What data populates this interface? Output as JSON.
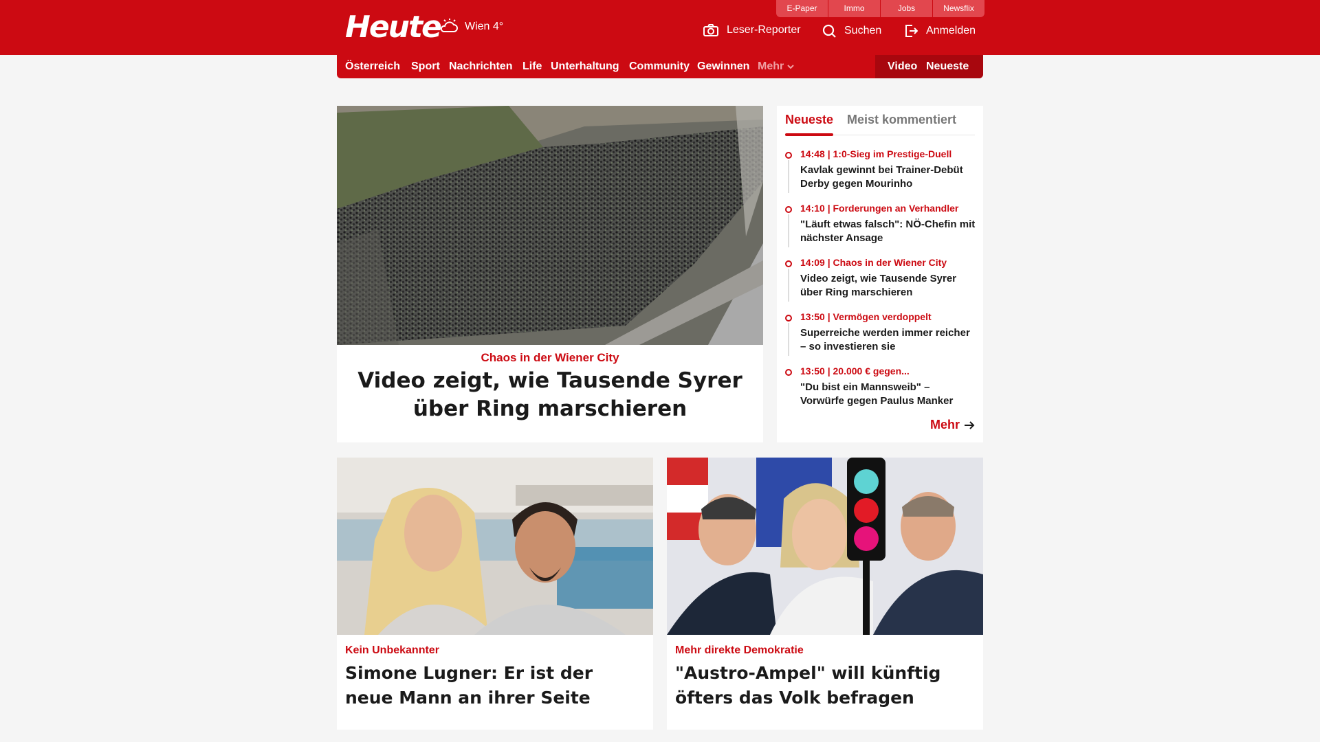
{
  "header": {
    "logo": "Heute",
    "weather": "Wien 4°",
    "service_tabs": [
      "E-Paper",
      "Immo",
      "Jobs",
      "Newsflix"
    ],
    "actions": {
      "reporter": "Leser-Reporter",
      "search": "Suchen",
      "login": "Anmelden"
    }
  },
  "nav": {
    "items": [
      "Österreich",
      "Sport",
      "Nachrichten",
      "Life",
      "Unterhaltung",
      "Community",
      "Gewinnen"
    ],
    "more": "Mehr",
    "video": "Video",
    "latest": "Neueste"
  },
  "hero": {
    "kicker": "Chaos in der Wiener City",
    "title": "Video zeigt, wie Tausende Syrer über Ring marschieren"
  },
  "sidebar": {
    "tabs": [
      "Neueste",
      "Meist kommentiert"
    ],
    "items": [
      {
        "meta": "14:48 | 1:0-Sieg im Prestige-Duell",
        "title": "Kavlak gewinnt bei Trainer-Debüt Derby gegen Mourinho"
      },
      {
        "meta": "14:10 | Forderungen an Verhandler",
        "title": "\"Läuft etwas falsch\": NÖ-Chefin mit nächster Ansage"
      },
      {
        "meta": "14:09 | Chaos in der Wiener City",
        "title": "Video zeigt, wie Tausende Syrer über Ring marschieren"
      },
      {
        "meta": "13:50 | Vermögen verdoppelt",
        "title": "Superreiche werden immer reicher – so investieren sie"
      },
      {
        "meta": "13:50 | 20.000 € gegen...",
        "title": "\"Du bist ein Mannsweib\" – Vorwürfe gegen Paulus Manker"
      }
    ],
    "more": "Mehr"
  },
  "articles": [
    {
      "kicker": "Kein Unbekannter",
      "title": "Simone Lugner: Er ist der neue Mann an ihrer Seite"
    },
    {
      "kicker": "Mehr direkte Demokratie",
      "title": "\"Austro-Ampel\" will künftig öfters das Volk befragen"
    }
  ],
  "colors": {
    "brand_red": "#cc0a12",
    "service_tab": "#e2474e",
    "nav_dark": "#a8070e"
  }
}
